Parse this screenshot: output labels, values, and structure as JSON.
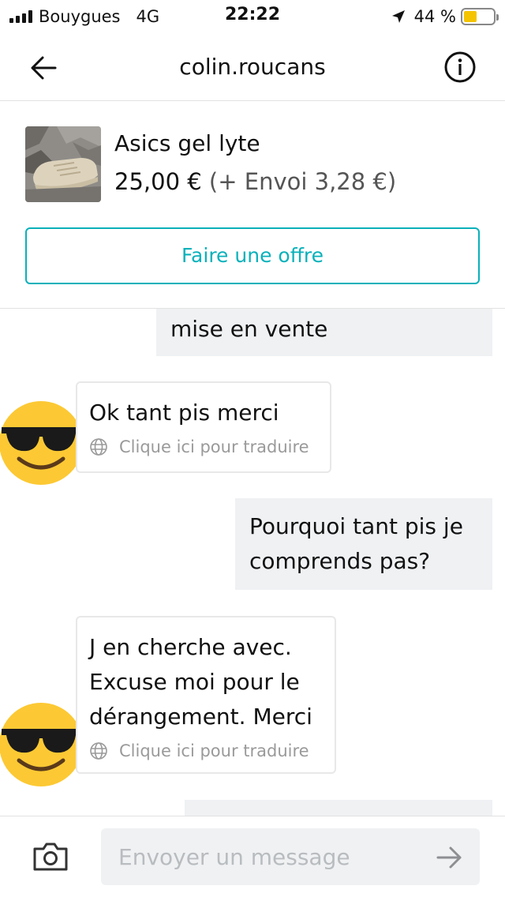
{
  "status_bar": {
    "carrier": "Bouygues",
    "network": "4G",
    "time": "22:22",
    "battery": "44 %",
    "battery_level": 0.44,
    "battery_color": "#f5c400"
  },
  "header": {
    "title": "colin.roucans",
    "back_icon": "arrow-left-icon",
    "info_icon": "info-icon"
  },
  "item": {
    "title": "Asics gel lyte",
    "price": "25,00 €",
    "shipping": "(+ Envoi 3,28 €)"
  },
  "offer_button": {
    "label": "Faire une offre"
  },
  "messages": {
    "translate_label": "Clique ici pour traduire",
    "out_1": "mise en vente",
    "in_1": "Ok tant pis merci",
    "out_2": [
      "Pourquoi tant pis je",
      "comprends pas?"
    ],
    "in_2": [
      "J en cherche avec.",
      "Excuse moi pour le",
      "dérangement. Merci"
    ]
  },
  "composer": {
    "placeholder": "Envoyer un message",
    "camera_icon": "camera-icon",
    "send_icon": "send-arrow-icon"
  },
  "colors": {
    "accent": "#09b1ba",
    "sent_bubble": "#eff1f3",
    "muted_text": "#9a9a9a"
  }
}
